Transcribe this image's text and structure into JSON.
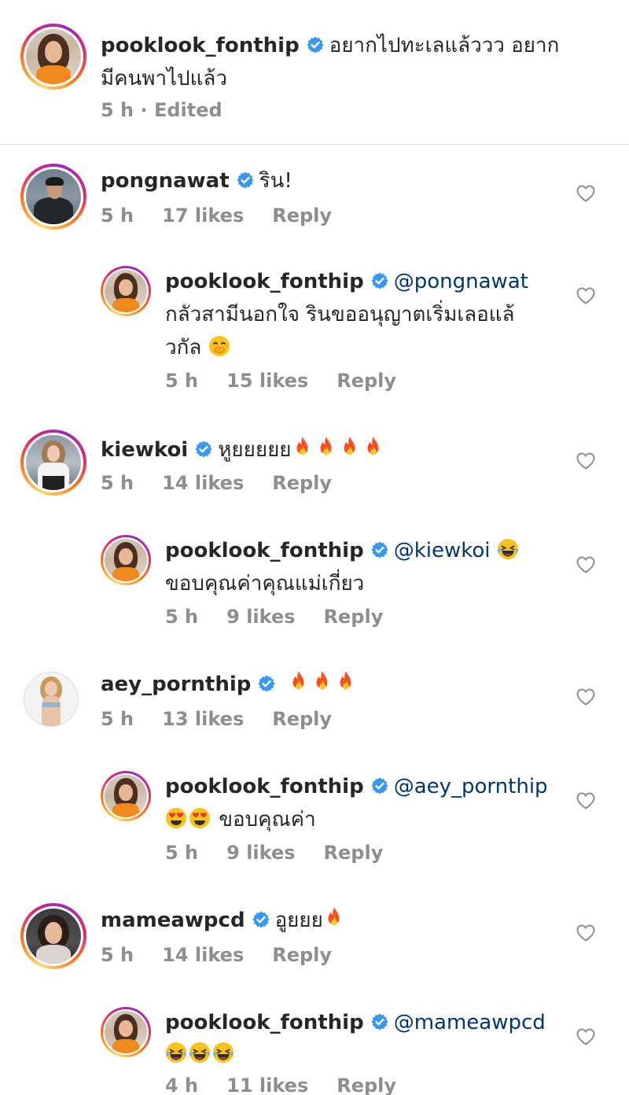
{
  "caption": {
    "username": "pooklook_fonthip",
    "text_line1": "อยากไปทะเลแล้ววว อยาก",
    "text_line2": "มีคนพาไปแล้ว",
    "time": "5 h",
    "separator": "·",
    "edited": "Edited"
  },
  "comments": [
    {
      "username": "pongnawat",
      "text": "ริน!",
      "time": "5 h",
      "likes": "17 likes",
      "reply": "Reply",
      "replies": [
        {
          "username": "pooklook_fonthip",
          "mention": "@pongnawat",
          "text_line1": "กลัวสามีนอกใจ รินขออนุญาตเริ่มเลอแล้",
          "text_line2": "วกัล",
          "emoji": "face-with-hand-over-mouth",
          "time": "5 h",
          "likes": "15 likes",
          "reply": "Reply"
        }
      ]
    },
    {
      "username": "kiewkoi",
      "text": "หูยยยยย",
      "emoji": "fire x4",
      "time": "5 h",
      "likes": "14 likes",
      "reply": "Reply",
      "replies": [
        {
          "username": "pooklook_fonthip",
          "mention": "@kiewkoi",
          "emoji": "grinning-squinting-face",
          "text_line2": "ขอบคุณค่าคุณแม่เกี่ยว",
          "time": "5 h",
          "likes": "9 likes",
          "reply": "Reply"
        }
      ]
    },
    {
      "username": "aey_pornthip",
      "emoji": "fire x3",
      "time": "5 h",
      "likes": "13 likes",
      "reply": "Reply",
      "replies": [
        {
          "username": "pooklook_fonthip",
          "mention": "@aey_pornthip",
          "emoji": "heart-eyes x2",
          "text_line2": "ขอบคุณค่า",
          "time": "5 h",
          "likes": "9 likes",
          "reply": "Reply"
        }
      ]
    },
    {
      "username": "mameawpcd",
      "text": "อูยยย",
      "emoji": "fire x1",
      "time": "5 h",
      "likes": "14 likes",
      "reply": "Reply",
      "replies": [
        {
          "username": "pooklook_fonthip",
          "mention": "@mameawpcd",
          "emoji": "tears-of-joy x3",
          "time": "4 h",
          "likes": "11 likes",
          "reply": "Reply"
        }
      ]
    }
  ],
  "colors": {
    "verified": "#3897f0",
    "mention": "#00376b",
    "meta": "#8e8e8e",
    "text": "#262626"
  },
  "icons": [
    "verified-badge-icon",
    "heart-outline-icon",
    "fire-emoji",
    "grinning-squinting-emoji",
    "heart-eyes-emoji",
    "tears-of-joy-emoji",
    "hand-over-mouth-emoji"
  ]
}
